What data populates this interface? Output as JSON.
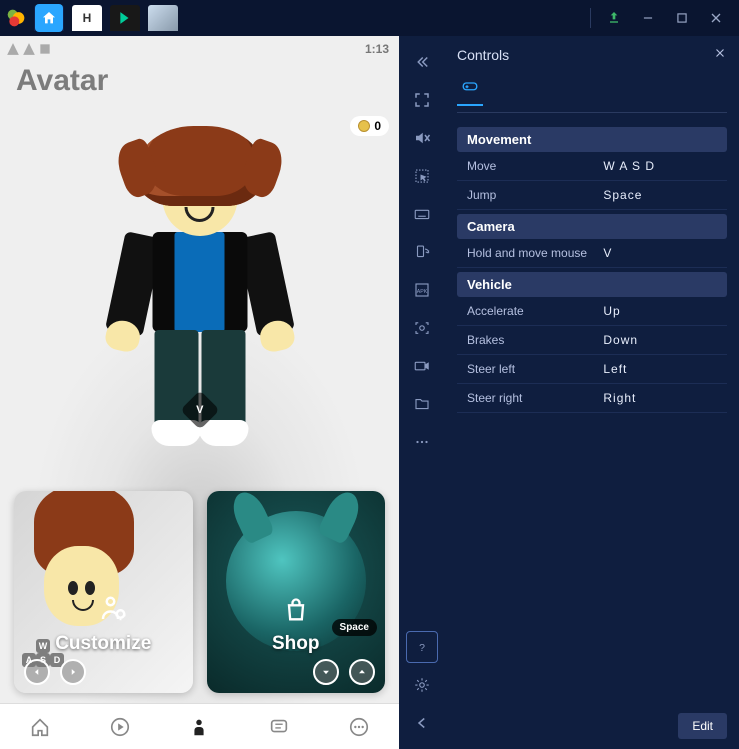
{
  "status_time": "1:13",
  "avatar_title": "Avatar",
  "currency_value": "0",
  "v_overlay": "V",
  "cards": {
    "customize": {
      "label": "Customize"
    },
    "shop": {
      "label": "Shop",
      "key": "Space"
    }
  },
  "wasd": {
    "w": "W",
    "a": "A",
    "s": "S",
    "d": "D"
  },
  "controls_panel": {
    "title": "Controls",
    "edit_label": "Edit",
    "sections": [
      {
        "title": "Movement",
        "rows": [
          {
            "label": "Move",
            "value": "W A S D"
          },
          {
            "label": "Jump",
            "value": "Space"
          }
        ]
      },
      {
        "title": "Camera",
        "rows": [
          {
            "label": "Hold and move mouse",
            "value": "V"
          }
        ]
      },
      {
        "title": "Vehicle",
        "rows": [
          {
            "label": "Accelerate",
            "value": "Up"
          },
          {
            "label": "Brakes",
            "value": "Down"
          },
          {
            "label": "Steer left",
            "value": "Left"
          },
          {
            "label": "Steer right",
            "value": "Right"
          }
        ]
      }
    ]
  }
}
